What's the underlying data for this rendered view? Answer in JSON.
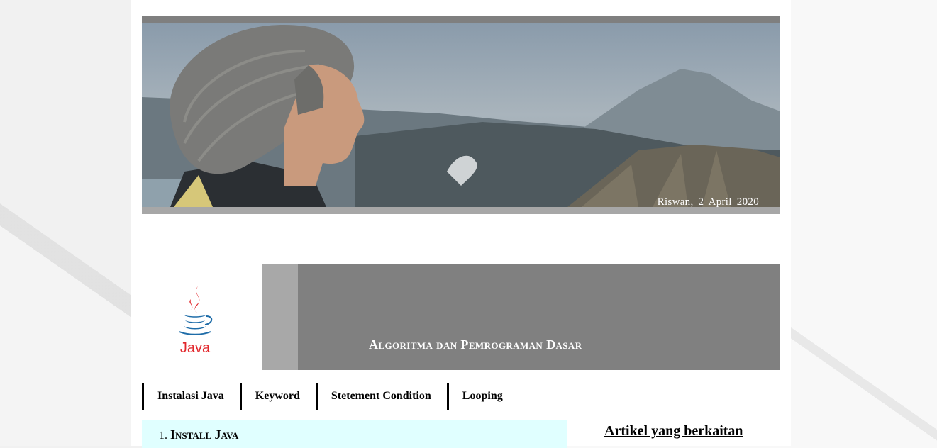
{
  "header": {
    "caption": "Riswan,  2  April  2020"
  },
  "banner": {
    "title": "Algoritma dan Pemrograman Dasar",
    "logo_text": "Java"
  },
  "nav": {
    "items": [
      {
        "label": "Instalasi Java"
      },
      {
        "label": "Keyword"
      },
      {
        "label": "Stetement Condition"
      },
      {
        "label": "Looping"
      }
    ]
  },
  "content": {
    "list_items": [
      {
        "label": "Install Java"
      }
    ]
  },
  "sidebar": {
    "heading": "Artikel yang berkaitan"
  },
  "colors": {
    "content_bg": "#e0ffff",
    "banner_bg": "#808080",
    "banner_strip": "#a8a8a8",
    "java_red": "#e2262b",
    "java_blue": "#1e6ca8"
  }
}
